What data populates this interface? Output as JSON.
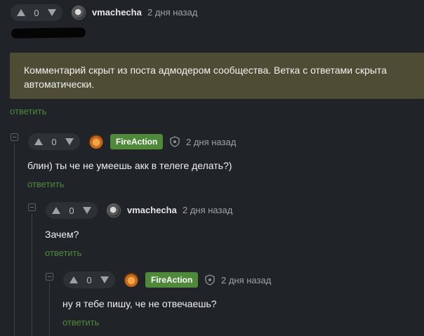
{
  "top_comment": {
    "score": "0",
    "username": "vmachecha",
    "time": "2 дня назад",
    "hidden_notice": "Комментарий скрыт из поста адмодером сообщества. Ветка с ответами скрыта автоматически.",
    "reply_label": "ответить"
  },
  "comments": [
    {
      "score": "0",
      "username": "FireAction",
      "time": "2 дня назад",
      "text": "блин) ты че не умеешь акк в телеге делать?)",
      "reply_label": "ответить"
    },
    {
      "score": "0",
      "username": "vmachecha",
      "time": "2 дня назад",
      "text": "Зачем?",
      "reply_label": "ответить"
    },
    {
      "score": "0",
      "username": "FireAction",
      "time": "2 дня назад",
      "text": "ну я тебе пишу, че не отвечаешь?",
      "reply_label": "ответить"
    }
  ],
  "colors": {
    "background": "#202327",
    "notice_bg": "#4f4c35",
    "accent_green": "#4f8a3a",
    "muted": "#9ea2a7"
  }
}
